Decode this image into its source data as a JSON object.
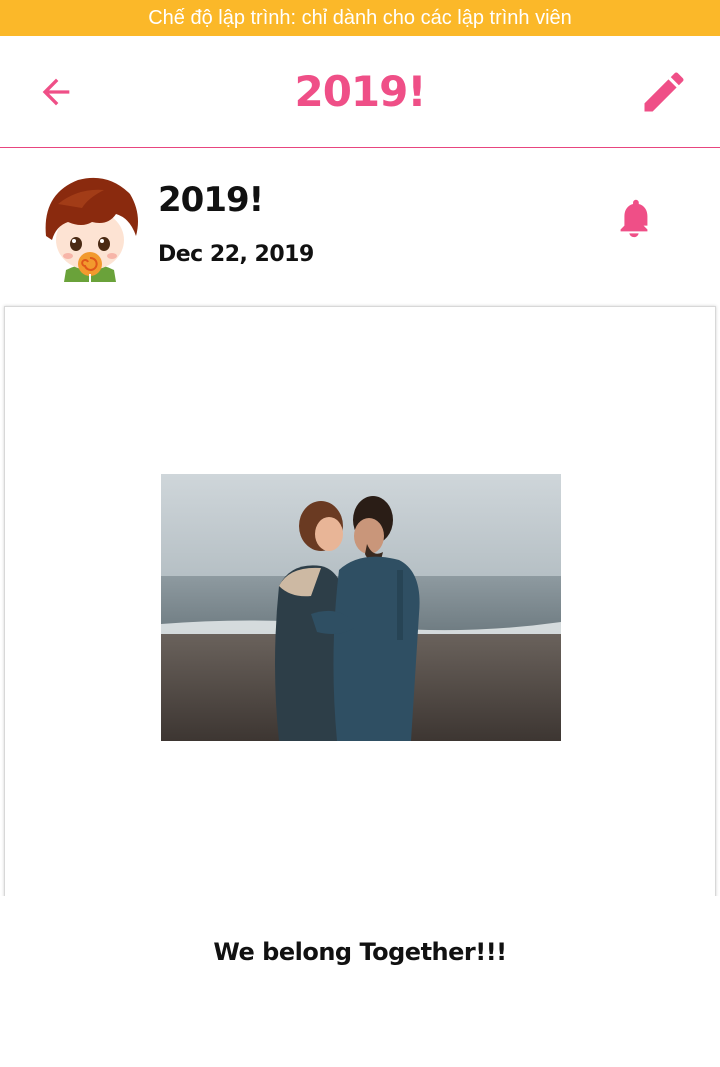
{
  "banner": {
    "text": "Chế độ lập trình: chỉ dành cho các lập trình viên"
  },
  "appbar": {
    "title": "2019!",
    "back_icon": "arrow-left-icon",
    "edit_icon": "pencil-icon",
    "accent_color": "#ef4f87"
  },
  "post": {
    "title": "2019!",
    "date": "Dec 22, 2019",
    "avatar": "cartoon-boy-lollipop-avatar",
    "notify_icon": "bell-icon",
    "caption": "We belong Together!!!",
    "photo": "couple-on-beach-photo"
  },
  "colors": {
    "banner": "#fbb829",
    "accent": "#ef4f87"
  }
}
